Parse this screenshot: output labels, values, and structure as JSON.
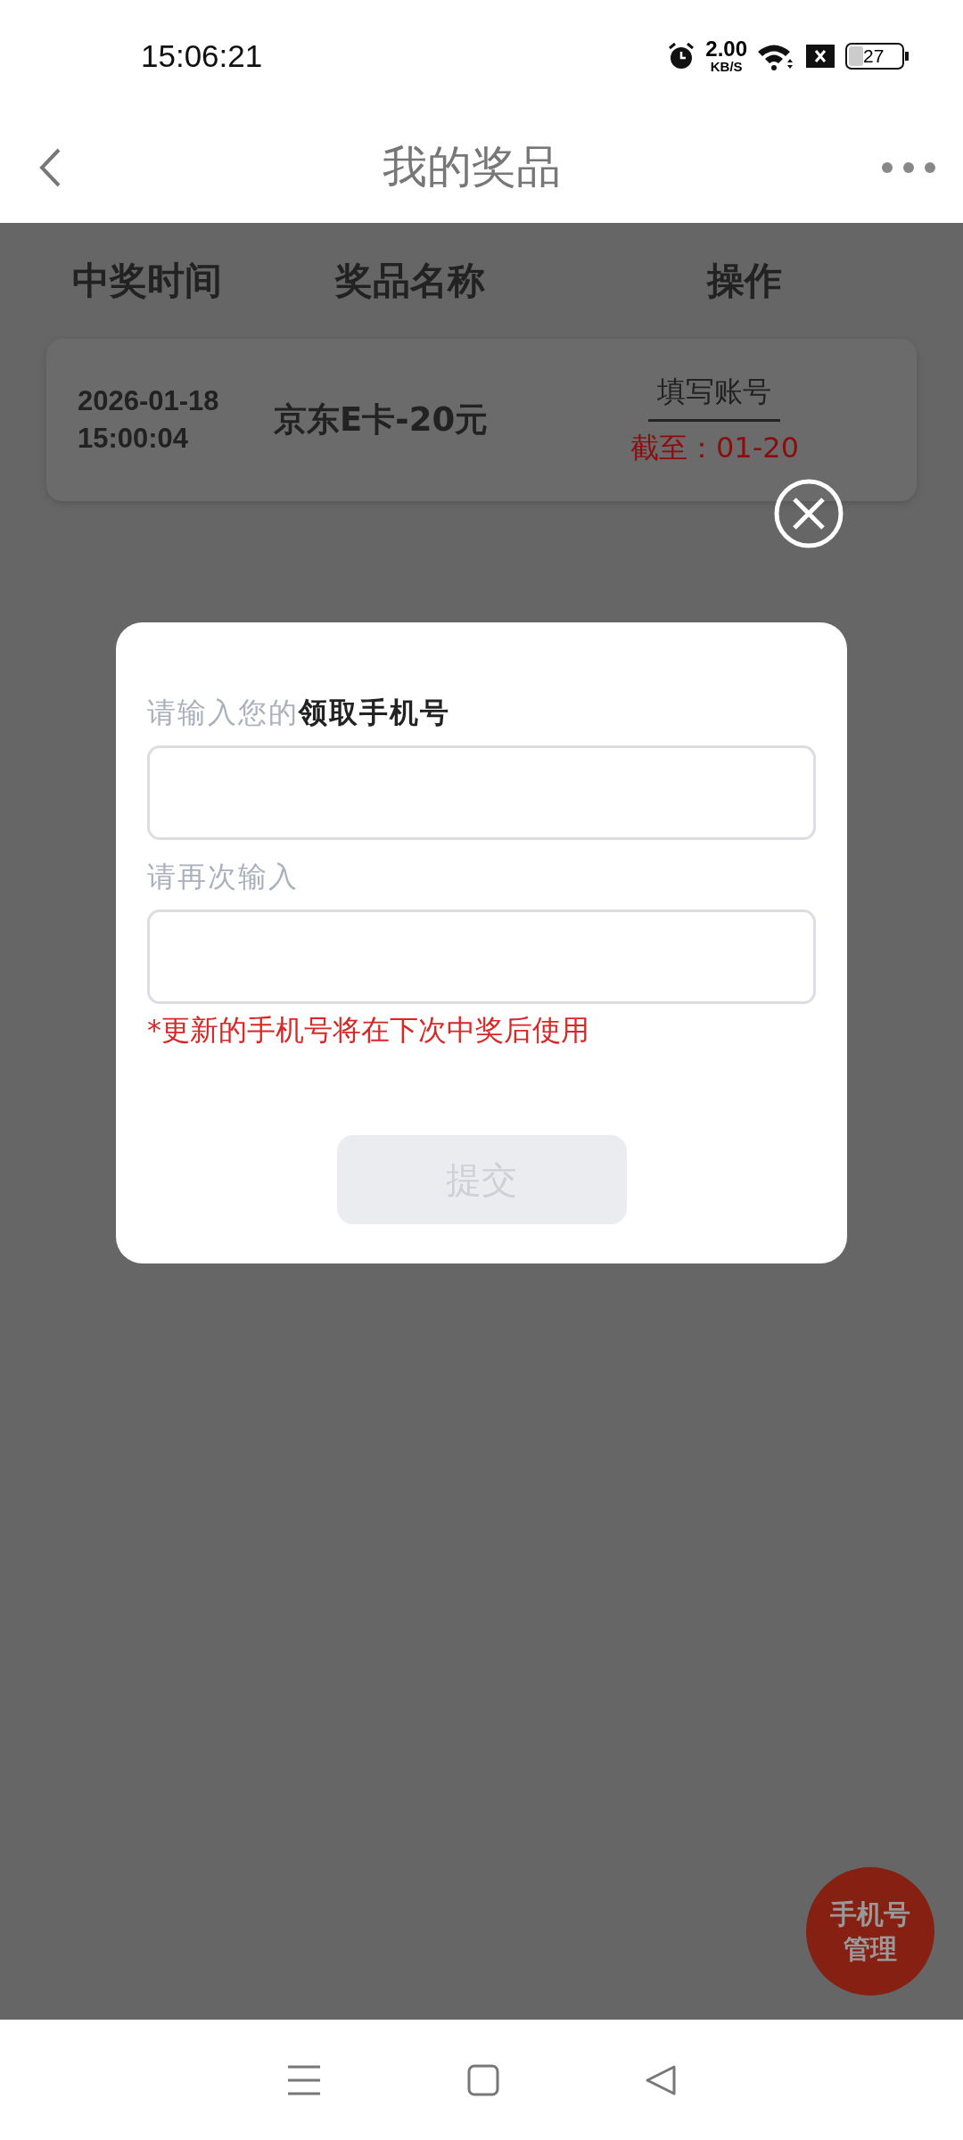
{
  "status_bar": {
    "time": "15:06:21",
    "net_speed": "2.00",
    "net_unit": "KB/S",
    "battery": "27"
  },
  "header": {
    "title": "我的奖品"
  },
  "table": {
    "columns": [
      "中奖时间",
      "奖品名称",
      "操作"
    ],
    "rows": [
      {
        "date": "2026-01-18",
        "time": "15:00:04",
        "prize": "京东E卡-20元",
        "action": "填写账号",
        "deadline": "截至：01-20"
      }
    ]
  },
  "dialog": {
    "label_1": "请输入您的**领取手机号**",
    "label_2": "请再次输入",
    "note": "*更新的手机号将在下次中奖后使用",
    "submit": {
      "label": "提交",
      "disabled": true
    }
  },
  "floating_button": {
    "label_1": "手机号",
    "label_2": "管理"
  }
}
